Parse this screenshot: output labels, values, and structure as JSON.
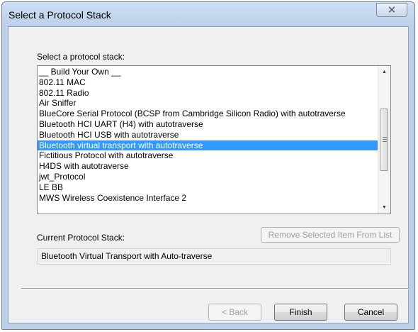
{
  "window": {
    "title": "Select a Protocol Stack",
    "close_glyph": "✕"
  },
  "list_section": {
    "label": "Select a protocol stack:",
    "items": [
      "__ Build Your Own __",
      "802.11 MAC",
      "802.11 Radio",
      "Air Sniffer",
      "BlueCore Serial Protocol (BCSP from Cambridge Silicon Radio) with autotraverse",
      "Bluetooth HCI UART (H4) with autotraverse",
      "Bluetooth HCI USB with autotraverse",
      "Bluetooth virtual transport with autotraverse",
      "Fictitious Protocol with autotraverse",
      "H4DS with autotraverse",
      "jwt_Protocol",
      "LE BB",
      "MWS Wireless Coexistence Interface 2"
    ],
    "selected_index": 7
  },
  "current_stack": {
    "label": "Current Protocol Stack:",
    "value": "Bluetooth Virtual Transport with Auto-traverse",
    "remove_button": "Remove Selected Item From List"
  },
  "buttons": {
    "back": "< Back",
    "finish": "Finish",
    "cancel": "Cancel"
  },
  "colors": {
    "selection": "#3399ff",
    "frame": "#bcd0e8",
    "client": "#f0f0f0"
  }
}
